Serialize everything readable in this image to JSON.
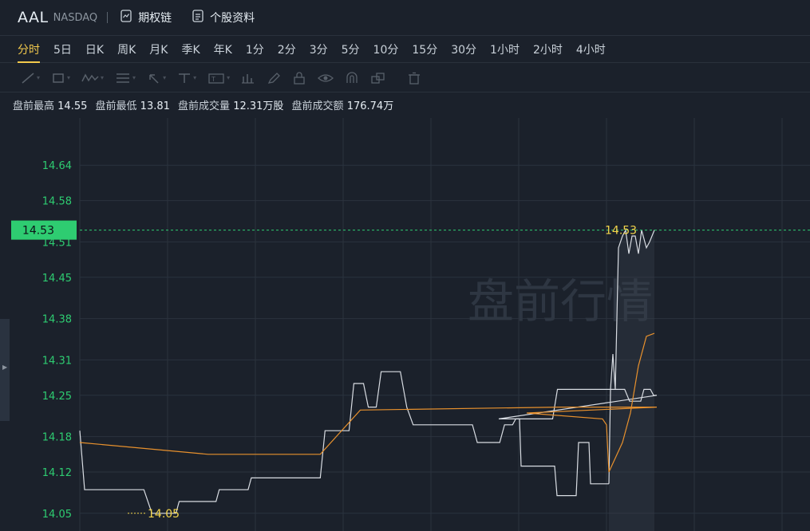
{
  "header": {
    "ticker": "AAL",
    "exchange": "NASDAQ",
    "links": [
      {
        "label": "期权链",
        "icon": "option-chain-icon"
      },
      {
        "label": "个股资料",
        "icon": "document-icon"
      }
    ]
  },
  "periods": [
    "分时",
    "5日",
    "日K",
    "周K",
    "月K",
    "季K",
    "年K",
    "1分",
    "2分",
    "3分",
    "5分",
    "10分",
    "15分",
    "30分",
    "1小时",
    "2小时",
    "4小时"
  ],
  "active_period": "分时",
  "toolbar": [
    "trend-line-icon",
    "rectangle-icon",
    "wave-icon",
    "fibonacci-icon",
    "arrow-icon",
    "horizontal-line-icon",
    "text-icon",
    "measure-icon",
    "brush-icon",
    "lock-icon",
    "eye-icon",
    "magnet-icon",
    "layers-icon",
    "trash-icon"
  ],
  "stats": {
    "high_label": "盘前最高",
    "high": "14.55",
    "low_label": "盘前最低",
    "low": "13.81",
    "vol_label": "盘前成交量",
    "vol": "12.31万股",
    "amt_label": "盘前成交额",
    "amt": "176.74万"
  },
  "watermark": "盘前行情",
  "colors": {
    "price": "#d9dde3",
    "avg": "#e8912d",
    "up": "#2ecc71",
    "label": "#f2d44b"
  },
  "chart_data": {
    "type": "line",
    "y_ticks": [
      "14.64",
      "14.58",
      "14.51",
      "14.45",
      "14.38",
      "14.31",
      "14.25",
      "14.18",
      "14.12",
      "14.05"
    ],
    "ylim": [
      14.02,
      14.72
    ],
    "current_price": "14.53",
    "max_label": "14.53",
    "min_label": "14.05",
    "x_count": 360,
    "series": [
      {
        "name": "",
        "points": [
          [
            0,
            14.19
          ],
          [
            3,
            14.09
          ],
          [
            40,
            14.09
          ],
          [
            45,
            14.05
          ],
          [
            60,
            14.05
          ],
          [
            62,
            14.07
          ],
          [
            85,
            14.07
          ],
          [
            87,
            14.09
          ],
          [
            105,
            14.09
          ],
          [
            107,
            14.11
          ],
          [
            150,
            14.11
          ],
          [
            153,
            14.19
          ],
          [
            168,
            14.19
          ],
          [
            171,
            14.27
          ],
          [
            177,
            14.27
          ],
          [
            180,
            14.23
          ],
          [
            185,
            14.23
          ],
          [
            188,
            14.29
          ],
          [
            200,
            14.29
          ],
          [
            204,
            14.23
          ],
          [
            208,
            14.2
          ],
          [
            245,
            14.2
          ],
          [
            248,
            14.17
          ],
          [
            262,
            14.17
          ],
          [
            265,
            14.2
          ],
          [
            270,
            14.2
          ],
          [
            272,
            14.21
          ],
          [
            295,
            14.21
          ],
          [
            298,
            14.26
          ],
          [
            340,
            14.26
          ],
          [
            343,
            14.24
          ],
          [
            350,
            14.24
          ],
          [
            352,
            14.26
          ],
          [
            356,
            14.26
          ],
          [
            358,
            14.25
          ],
          [
            360,
            14.25
          ]
        ]
      },
      {
        "name": "",
        "points": [
          [
            0,
            14.17
          ],
          [
            80,
            14.15
          ],
          [
            150,
            14.15
          ],
          [
            175,
            14.225
          ],
          [
            300,
            14.23
          ],
          [
            360,
            14.23
          ]
        ]
      }
    ]
  }
}
